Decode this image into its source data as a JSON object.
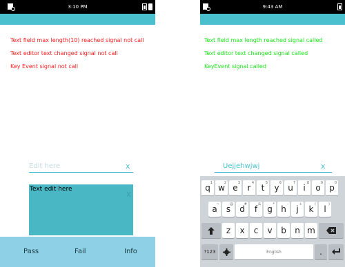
{
  "left": {
    "status_time": "3:10 PM",
    "messages": [
      "Text field max length(10) reached signal not call",
      "Text editor text changed signal not call",
      "Key Event signal not call"
    ],
    "entry_placeholder": "Edit here",
    "entry_clear": "x",
    "editor_text": "Text edit here",
    "editor_clear": "x",
    "footer": {
      "pass": "Pass",
      "fail": "Fail",
      "info": "Info"
    }
  },
  "right": {
    "status_time": "9:43 AM",
    "messages": [
      "Text field max length reached signal called",
      "Text editor text changed signal called",
      "KeyEvent signal called"
    ],
    "entry_value": "Uejjehwjwj",
    "entry_clear": "x",
    "keyboard": {
      "row1": [
        {
          "key": "q",
          "hint": "1"
        },
        {
          "key": "w",
          "hint": "2"
        },
        {
          "key": "e",
          "hint": "3"
        },
        {
          "key": "r",
          "hint": "4"
        },
        {
          "key": "t",
          "hint": "5"
        },
        {
          "key": "y",
          "hint": "6"
        },
        {
          "key": "u",
          "hint": "7"
        },
        {
          "key": "i",
          "hint": "8"
        },
        {
          "key": "o",
          "hint": "9"
        },
        {
          "key": "p",
          "hint": "0"
        }
      ],
      "row2": [
        {
          "key": "a",
          "hint": "~"
        },
        {
          "key": "s",
          "hint": "@"
        },
        {
          "key": "d",
          "hint": "#"
        },
        {
          "key": "f",
          "hint": "&"
        },
        {
          "key": "g",
          "hint": "*"
        },
        {
          "key": "h",
          "hint": "-"
        },
        {
          "key": "j",
          "hint": "+"
        },
        {
          "key": "k",
          "hint": "("
        },
        {
          "key": "l",
          "hint": ")"
        }
      ],
      "row3": [
        "z",
        "x",
        "c",
        "v",
        "b",
        "n",
        "m"
      ],
      "shift_icon": "shift-icon",
      "backspace_icon": "backspace-icon",
      "sym_label": "?123",
      "settings_icon": "gear-icon",
      "space_label": "English",
      "period_label": ".",
      "enter_icon": "enter-icon"
    }
  },
  "colors": {
    "accent": "#4abfcd",
    "error": "#ff1a1a",
    "success": "#19e519",
    "footer": "#8ed0e6"
  }
}
